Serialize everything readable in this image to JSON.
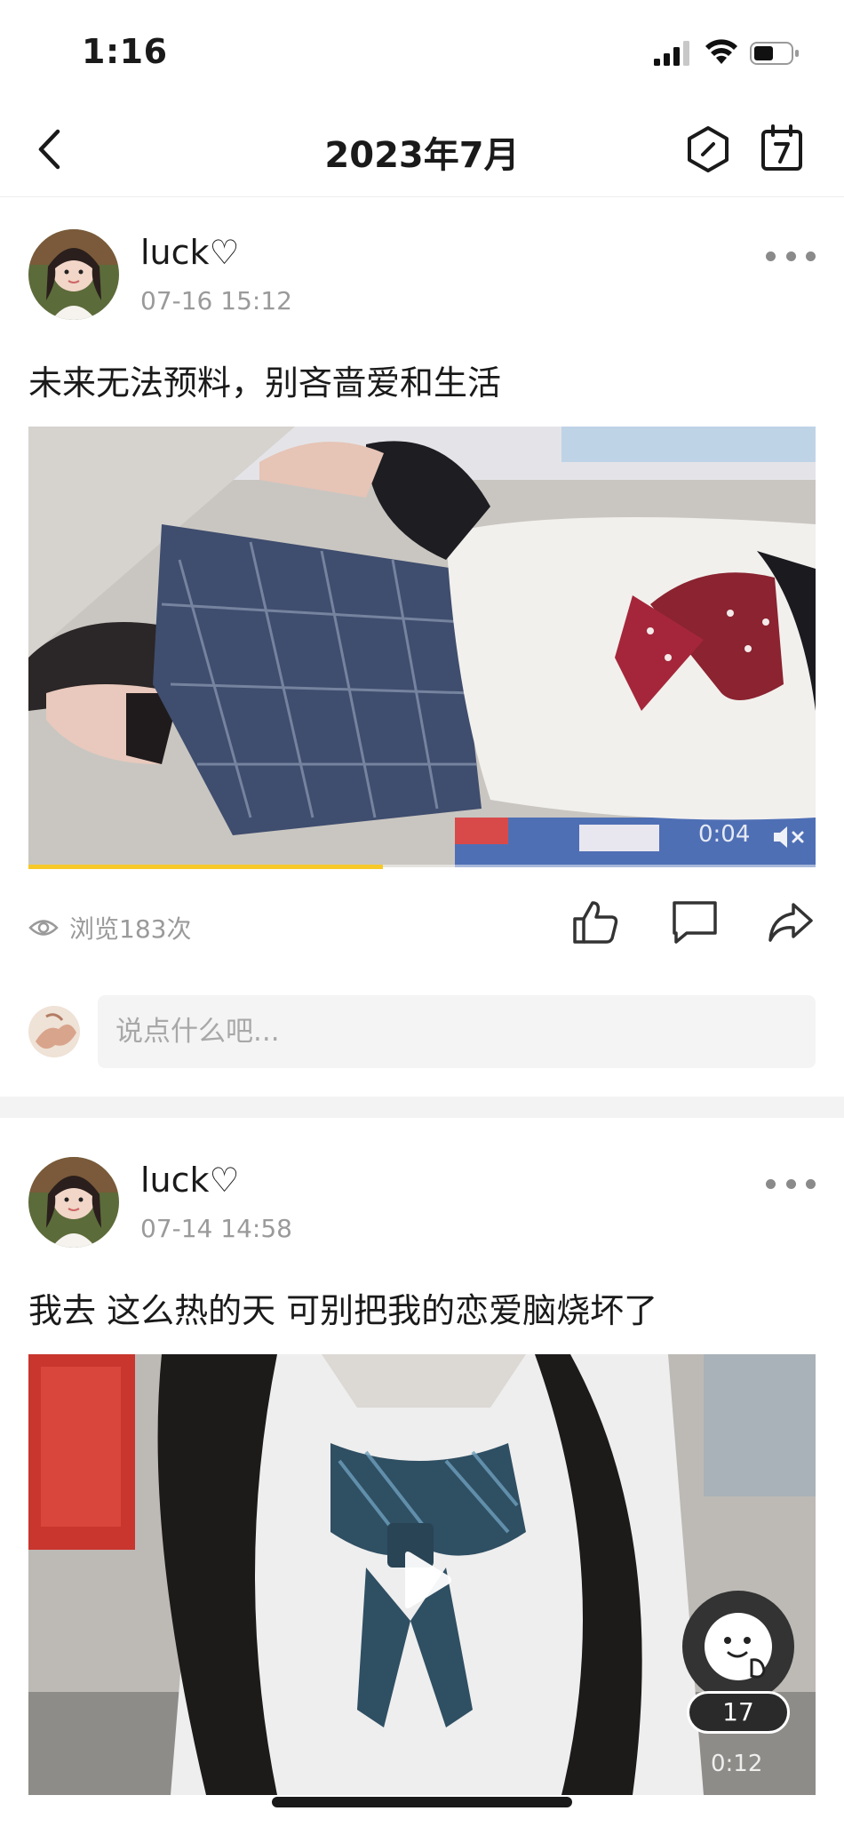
{
  "status_bar": {
    "time": "1:16"
  },
  "header": {
    "title": "2023年7月"
  },
  "posts": [
    {
      "username": "luck♡",
      "time": "07-16 15:12",
      "text": "未来无法预料，别吝啬爱和生活",
      "video": {
        "duration": "0:04",
        "progress": 0.45
      },
      "views": "浏览183次",
      "comment_placeholder": "说点什么吧..."
    },
    {
      "username": "luck♡",
      "time": "07-14 14:58",
      "text": "我去 这么热的天 可别把我的恋爱脑烧坏了",
      "video": {
        "duration": "0:12"
      }
    }
  ],
  "floating": {
    "count": "17"
  },
  "colors": {
    "progress": "#f7c928",
    "muted_text": "#9a9a9a"
  },
  "icons": [
    "back-icon",
    "hexagon-icon",
    "calendar-icon",
    "more-icon",
    "eye-icon",
    "like-icon",
    "comment-icon",
    "share-icon",
    "mute-icon",
    "play-icon",
    "mascot-icon"
  ]
}
